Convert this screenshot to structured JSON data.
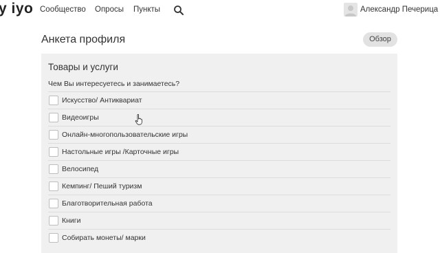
{
  "header": {
    "logo": "y iyo",
    "nav": [
      "Сообщество",
      "Опросы",
      "Пункты"
    ],
    "icons": {
      "search": "search-icon",
      "avatar": "user-avatar-icon"
    },
    "user_name": "Александр Печерица"
  },
  "page": {
    "title": "Анкета профиля",
    "overview_label": "Обзор"
  },
  "section": {
    "title": "Товары и услуги",
    "question": "Чем Вы интересуетесь и занимаетесь?",
    "options": [
      {
        "label": "Искусство/ Антиквариат",
        "checked": false
      },
      {
        "label": "Видеоигры",
        "checked": false
      },
      {
        "label": "Онлайн-многопользовательские игры",
        "checked": false
      },
      {
        "label": "Настольные игры /Карточные игры",
        "checked": false
      },
      {
        "label": "Велосипед",
        "checked": false
      },
      {
        "label": "Кемпинг/ Пеший туризм",
        "checked": false
      },
      {
        "label": "Благотворительная работа",
        "checked": false
      },
      {
        "label": "Книги",
        "checked": false
      },
      {
        "label": "Собирать монеты/ марки",
        "checked": false
      }
    ]
  },
  "colors": {
    "panel_bg": "#f0f0f0",
    "button_bg": "#e2e2e2",
    "text": "#333333"
  }
}
